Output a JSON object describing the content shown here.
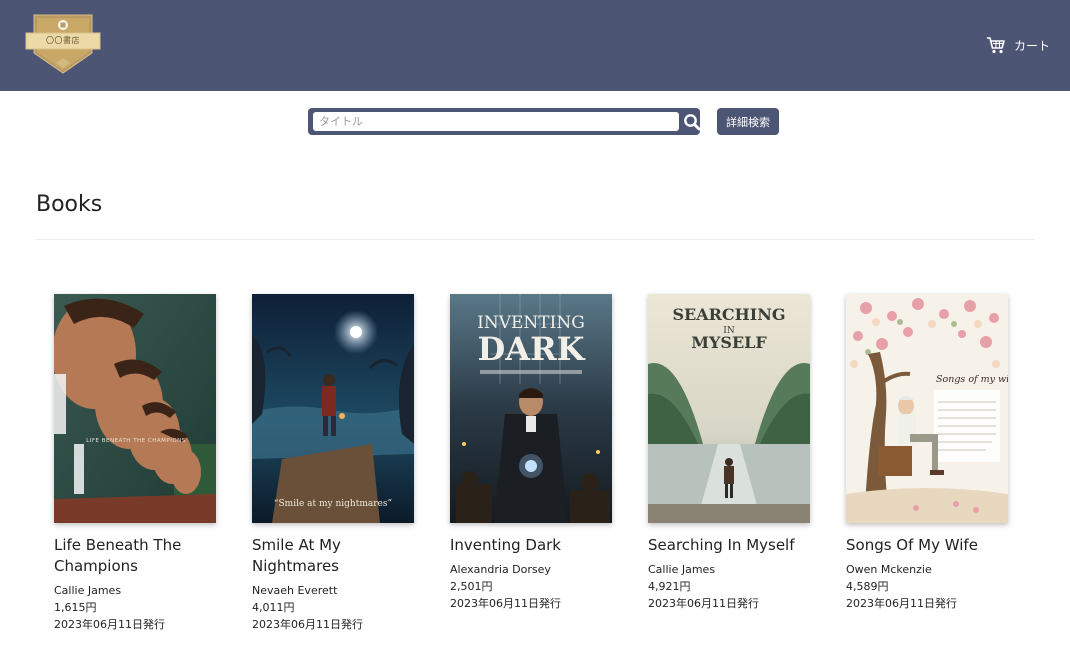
{
  "header": {
    "logo_text": "〇〇書店",
    "cart_label": "カート"
  },
  "search": {
    "placeholder": "タイトル",
    "value": "",
    "advanced_label": "詳細検索"
  },
  "section": {
    "title": "Books"
  },
  "colors": {
    "header_bg": "#4d5574",
    "logo_gold": "#c9a767",
    "text": "#222222"
  },
  "books": [
    {
      "title": "Life Beneath The Champions",
      "author": "Callie James",
      "price": "1,615円",
      "date": "2023年06月11日発行",
      "cover_text": "LIFE BENEATH THE CHAMPIONS"
    },
    {
      "title": "Smile At My Nightmares",
      "author": "Nevaeh Everett",
      "price": "4,011円",
      "date": "2023年06月11日発行",
      "cover_text": "“Smile at my nightmares”"
    },
    {
      "title": "Inventing Dark",
      "author": "Alexandria Dorsey",
      "price": "2,501円",
      "date": "2023年06月11日発行",
      "cover_line1": "INVENTING",
      "cover_line2": "DARK"
    },
    {
      "title": "Searching In Myself",
      "author": "Callie James",
      "price": "4,921円",
      "date": "2023年06月11日発行",
      "cover_line1": "SEARCHING",
      "cover_line2": "IN",
      "cover_line3": "MYSELF"
    },
    {
      "title": "Songs Of My Wife",
      "author": "Owen Mckenzie",
      "price": "4,589円",
      "date": "2023年06月11日発行",
      "cover_text": "Songs of my wife"
    }
  ]
}
